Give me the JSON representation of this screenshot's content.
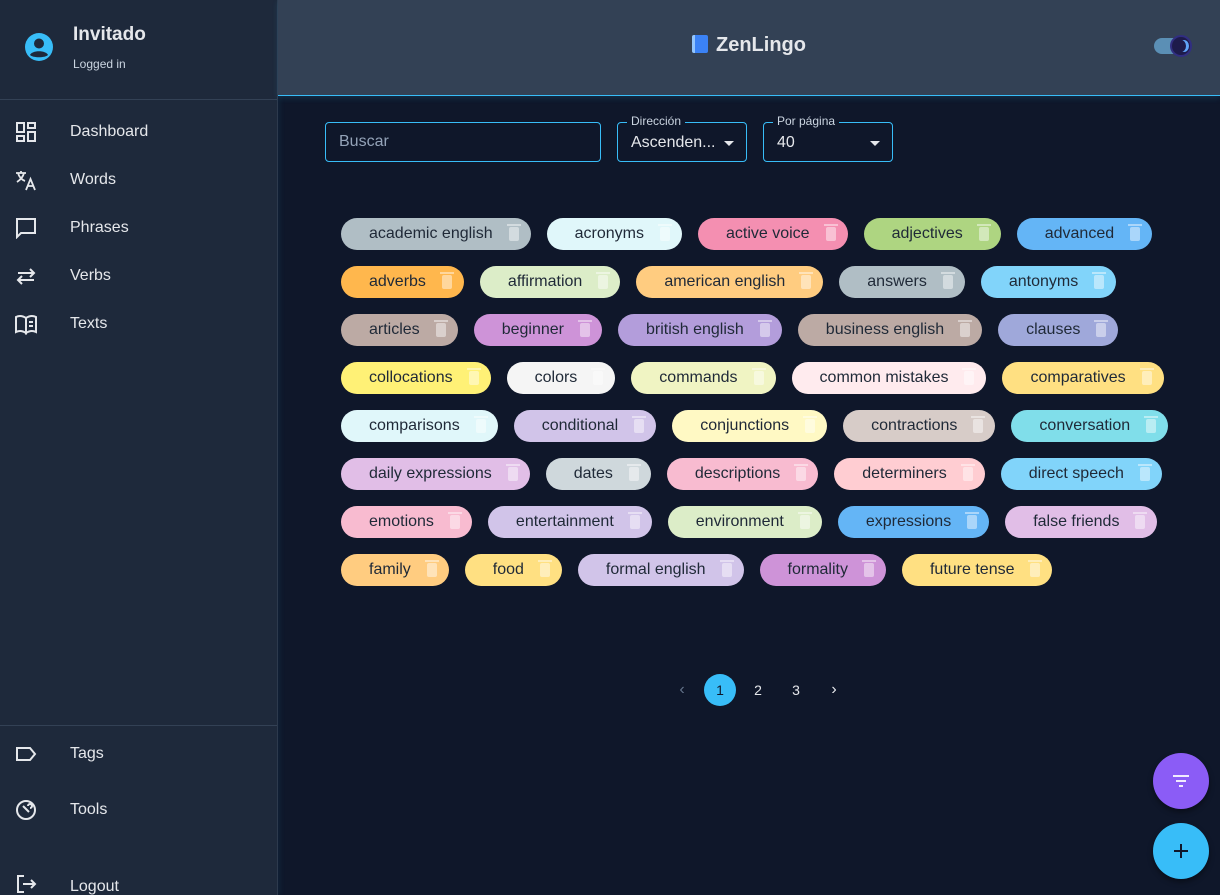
{
  "app": {
    "title": "ZenLingo"
  },
  "profile": {
    "name": "Invitado",
    "status": "Logged in"
  },
  "nav": [
    {
      "label": "Dashboard",
      "icon": "dashboard-icon"
    },
    {
      "label": "Words",
      "icon": "translate-icon"
    },
    {
      "label": "Phrases",
      "icon": "chat-bubble-icon"
    },
    {
      "label": "Verbs",
      "icon": "repeat-icon"
    },
    {
      "label": "Texts",
      "icon": "book-open-icon"
    }
  ],
  "nav_bottom": [
    {
      "label": "Tags",
      "icon": "tag-icon"
    },
    {
      "label": "Tools",
      "icon": "wrench-icon"
    },
    {
      "label": "Logout",
      "icon": "logout-icon"
    }
  ],
  "filters": {
    "search_placeholder": "Buscar",
    "direction_label": "Dirección",
    "direction_value": "Ascenden...",
    "per_page_label": "Por página",
    "per_page_value": "40"
  },
  "tags": [
    {
      "name": "academic english",
      "color": "#b0bec5"
    },
    {
      "name": "acronyms",
      "color": "#e0f7fa"
    },
    {
      "name": "active voice",
      "color": "#f48fb1"
    },
    {
      "name": "adjectives",
      "color": "#aed581"
    },
    {
      "name": "advanced",
      "color": "#64b5f6"
    },
    {
      "name": "adverbs",
      "color": "#ffb74d"
    },
    {
      "name": "affirmation",
      "color": "#dcedc8"
    },
    {
      "name": "american english",
      "color": "#ffcc80"
    },
    {
      "name": "answers",
      "color": "#b0bec5"
    },
    {
      "name": "antonyms",
      "color": "#81d4fa"
    },
    {
      "name": "articles",
      "color": "#bcaaa4"
    },
    {
      "name": "beginner",
      "color": "#ce93d8"
    },
    {
      "name": "british english",
      "color": "#b39ddb"
    },
    {
      "name": "business english",
      "color": "#bcaaa4"
    },
    {
      "name": "clauses",
      "color": "#9fa8da"
    },
    {
      "name": "collocations",
      "color": "#fff176"
    },
    {
      "name": "colors",
      "color": "#f5f5f5"
    },
    {
      "name": "commands",
      "color": "#f0f4c3"
    },
    {
      "name": "common mistakes",
      "color": "#ffebee"
    },
    {
      "name": "comparatives",
      "color": "#ffe082"
    },
    {
      "name": "comparisons",
      "color": "#e0f7fa"
    },
    {
      "name": "conditional",
      "color": "#d1c4e9"
    },
    {
      "name": "conjunctions",
      "color": "#fff9c4"
    },
    {
      "name": "contractions",
      "color": "#d7ccc8"
    },
    {
      "name": "conversation",
      "color": "#80deea"
    },
    {
      "name": "daily expressions",
      "color": "#e1bee7"
    },
    {
      "name": "dates",
      "color": "#cfd8dc"
    },
    {
      "name": "descriptions",
      "color": "#f8bbd0"
    },
    {
      "name": "determiners",
      "color": "#ffcdd2"
    },
    {
      "name": "direct speech",
      "color": "#81d4fa"
    },
    {
      "name": "emotions",
      "color": "#f8bbd0"
    },
    {
      "name": "entertainment",
      "color": "#d1c4e9"
    },
    {
      "name": "environment",
      "color": "#dcedc8"
    },
    {
      "name": "expressions",
      "color": "#64b5f6"
    },
    {
      "name": "false friends",
      "color": "#e1bee7"
    },
    {
      "name": "family",
      "color": "#ffcc80"
    },
    {
      "name": "food",
      "color": "#ffe082"
    },
    {
      "name": "formal english",
      "color": "#d1c4e9"
    },
    {
      "name": "formality",
      "color": "#ce93d8"
    },
    {
      "name": "future tense",
      "color": "#ffe082"
    }
  ],
  "pagination": {
    "pages": [
      "1",
      "2",
      "3"
    ],
    "current": 1
  },
  "colors": {
    "accent": "#38bdf8",
    "fab_filter": "#8b5cf6"
  }
}
